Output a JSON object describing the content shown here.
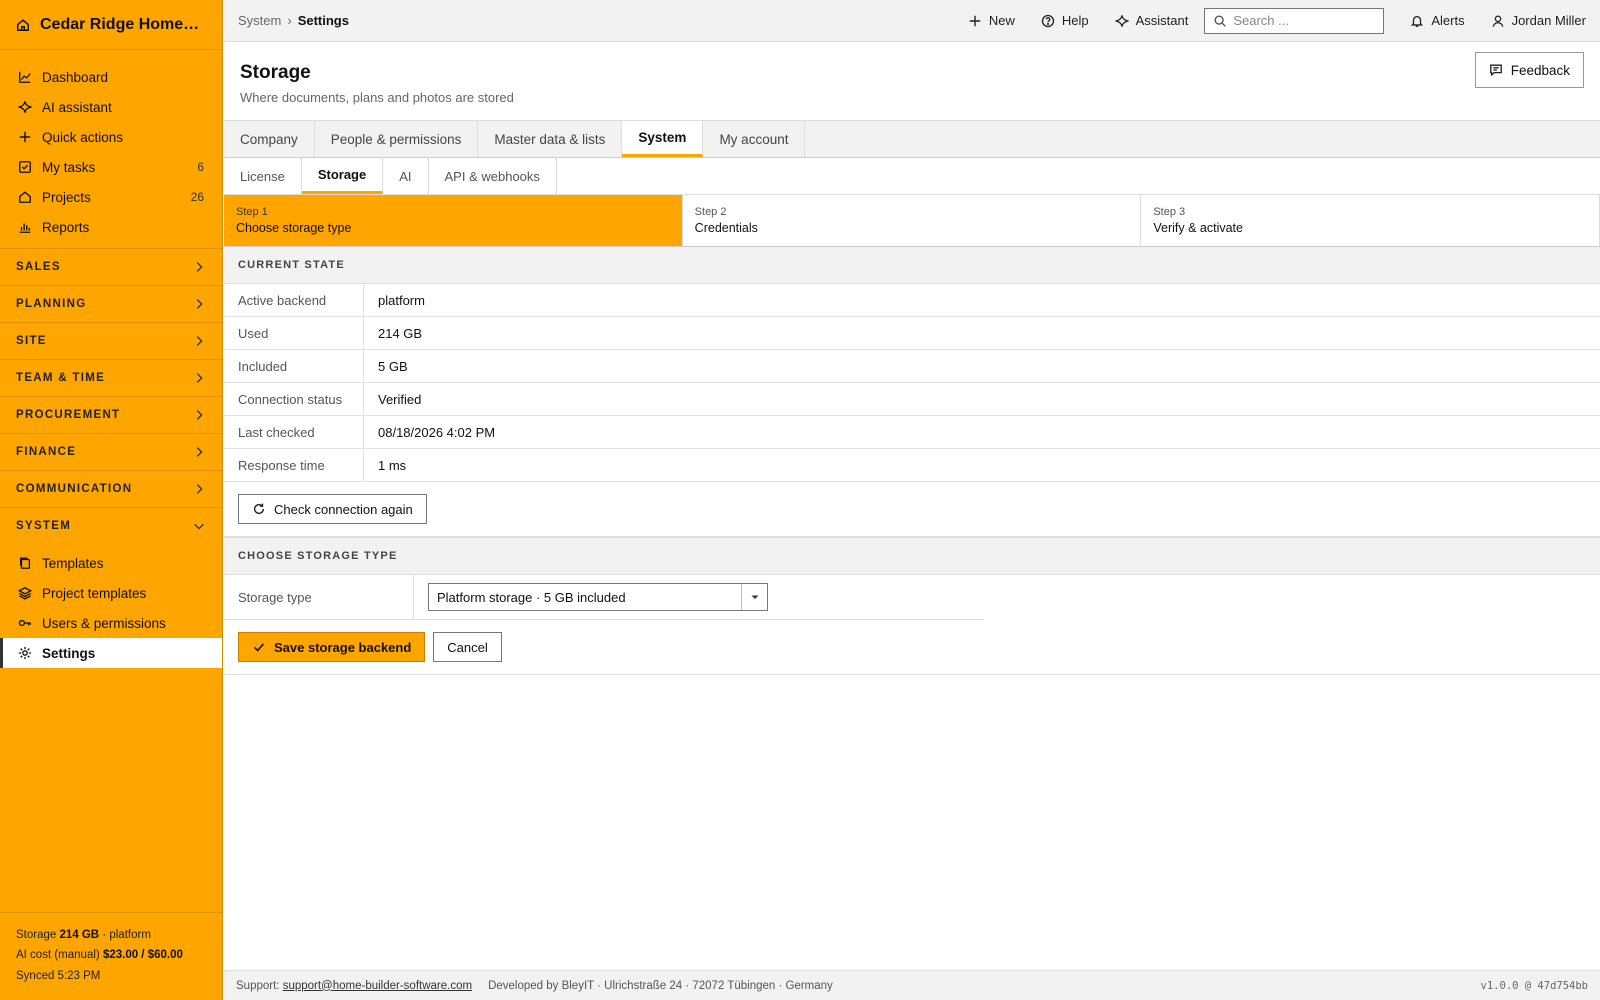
{
  "brand": {
    "name": "Cedar Ridge Homes L..."
  },
  "sidebar": {
    "top_items": [
      {
        "label": "Dashboard",
        "icon": "chart-line-icon",
        "badge": ""
      },
      {
        "label": "AI assistant",
        "icon": "sparkle-icon",
        "badge": ""
      },
      {
        "label": "Quick actions",
        "icon": "plus-icon",
        "badge": ""
      },
      {
        "label": "My tasks",
        "icon": "checkbox-icon",
        "badge": "6"
      },
      {
        "label": "Projects",
        "icon": "home-icon",
        "badge": "26"
      },
      {
        "label": "Reports",
        "icon": "bar-chart-icon",
        "badge": ""
      }
    ],
    "sections": [
      "SALES",
      "PLANNING",
      "SITE",
      "TEAM & TIME",
      "PROCUREMENT",
      "FINANCE",
      "COMMUNICATION"
    ],
    "system_section": "SYSTEM",
    "system_items": [
      {
        "label": "Templates",
        "icon": "copy-icon"
      },
      {
        "label": "Project templates",
        "icon": "layers-icon"
      },
      {
        "label": "Users & permissions",
        "icon": "key-icon"
      },
      {
        "label": "Settings",
        "icon": "gear-icon"
      }
    ],
    "footer": {
      "storage_prefix": "Storage",
      "storage_value": "214 GB",
      "storage_suffix": "· platform",
      "ai_prefix": "AI cost (manual)",
      "ai_value": "$23.00 / $60.00",
      "synced": "Synced 5:23 PM"
    }
  },
  "topbar": {
    "breadcrumb": [
      "System",
      "Settings"
    ],
    "breadcrumb_sep": "›",
    "new_label": "New",
    "help_label": "Help",
    "assistant_label": "Assistant",
    "search_placeholder": "Search ...",
    "alerts_label": "Alerts",
    "user_name": "Jordan Miller"
  },
  "page": {
    "title": "Storage",
    "subtitle": "Where documents, plans and photos are stored",
    "feedback_label": "Feedback"
  },
  "tabs": [
    "Company",
    "People & permissions",
    "Master data & lists",
    "System",
    "My account"
  ],
  "subtabs": [
    "License",
    "Storage",
    "AI",
    "API & webhooks"
  ],
  "steps": [
    {
      "num": "Step 1",
      "name": "Choose storage type"
    },
    {
      "num": "Step 2",
      "name": "Credentials"
    },
    {
      "num": "Step 3",
      "name": "Verify & activate"
    }
  ],
  "current_state": {
    "heading": "CURRENT STATE",
    "rows": [
      {
        "label": "Active backend",
        "value": "platform"
      },
      {
        "label": "Used",
        "value": "214 GB"
      },
      {
        "label": "Included",
        "value": "5 GB"
      },
      {
        "label": "Connection status",
        "value": "Verified"
      },
      {
        "label": "Last checked",
        "value": "08/18/2026 4:02 PM"
      },
      {
        "label": "Response time",
        "value": "1 ms"
      }
    ],
    "check_button": "Check connection again"
  },
  "choose": {
    "heading": "CHOOSE STORAGE TYPE",
    "label": "Storage type",
    "selected": "Platform storage · 5 GB included",
    "save_button": "Save storage backend",
    "cancel_button": "Cancel"
  },
  "footer": {
    "support_prefix": "Support:",
    "support_email": "support@home-builder-software.com",
    "developer": "Developed by BleyIT · Ulrichstraße 24 · 72072 Tübingen · Germany",
    "version": "v1.0.0 @ 47d754bb"
  },
  "colors": {
    "accent": "#FFA500",
    "background": "#ffffff",
    "panel": "#f2f2f2"
  }
}
